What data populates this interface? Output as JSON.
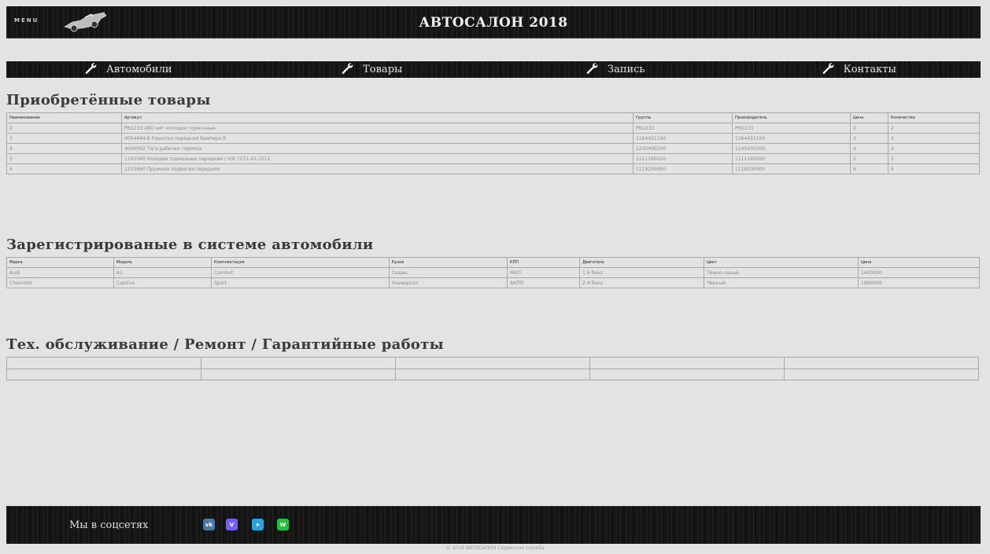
{
  "header": {
    "menu_label": "MENU",
    "title": "АВТОСАЛОН 2018"
  },
  "nav": {
    "items": [
      {
        "label": "Автомобили",
        "icon": "wrench-icon"
      },
      {
        "label": "Товары",
        "icon": "wrench-icon"
      },
      {
        "label": "Запись",
        "icon": "wrench-icon"
      },
      {
        "label": "Контакты",
        "icon": "wrench-icon"
      }
    ]
  },
  "goods": {
    "title": "Приобретённые товары",
    "columns": [
      "Наименование",
      "Артикул",
      "Группа",
      "Производитель",
      "Цена",
      "Количество"
    ],
    "rows": [
      [
        "2",
        "PN1233 4BO кит колодки тормозные",
        "PN1233",
        "PN1233",
        "2",
        "2"
      ],
      [
        "3",
        "0004494-B Решетка передняя бампера R",
        "1164451160",
        "1164451160",
        "3",
        "3"
      ],
      [
        "4",
        "4040002 Тяга рабочая тормоза",
        "1245400200",
        "1245400200",
        "4",
        "4"
      ],
      [
        "5",
        "1101040 Колодки тормозные передние / VW 7231-42-1512",
        "1111160200",
        "1111160200",
        "5",
        "5"
      ],
      [
        "6",
        "1103460 Пружина подвески передняя",
        "1119200400",
        "1119200400",
        "6",
        "6"
      ]
    ]
  },
  "cars": {
    "title": "Зарегистрированые в системе автомобили",
    "columns": [
      "Марка",
      "Модель",
      "Комплектация",
      "Кузов",
      "КПП",
      "Двигатель",
      "Цвет",
      "Цена"
    ],
    "rows": [
      [
        "Audi",
        "A1",
        "Comfort",
        "Седан",
        "МКП",
        "1.6 бенз",
        "Темно-серый",
        "1400000"
      ],
      [
        "Chevrolet",
        "Captiva",
        "Sport",
        "Универсал",
        "АКПП",
        "2.4 бенз",
        "Черный",
        "1890000"
      ]
    ]
  },
  "service": {
    "title": "Тех. обслуживание / Ремонт / Гарантийные работы",
    "rows": [
      [
        "",
        "",
        "",
        "",
        ""
      ],
      [
        "",
        "",
        "",
        "",
        ""
      ]
    ]
  },
  "footer": {
    "social_label": "Мы в соцсетях",
    "social": [
      {
        "name": "vk",
        "glyph": "vk",
        "color": "#4a76a8"
      },
      {
        "name": "viber",
        "glyph": "V",
        "color": "#7360f2"
      },
      {
        "name": "telegram",
        "glyph": "➤",
        "color": "#2aa3dd"
      },
      {
        "name": "whatsapp",
        "glyph": "W",
        "color": "#25c03a"
      }
    ],
    "copyright": "© 2018 АВТОСАЛОН Сервисная служба"
  }
}
